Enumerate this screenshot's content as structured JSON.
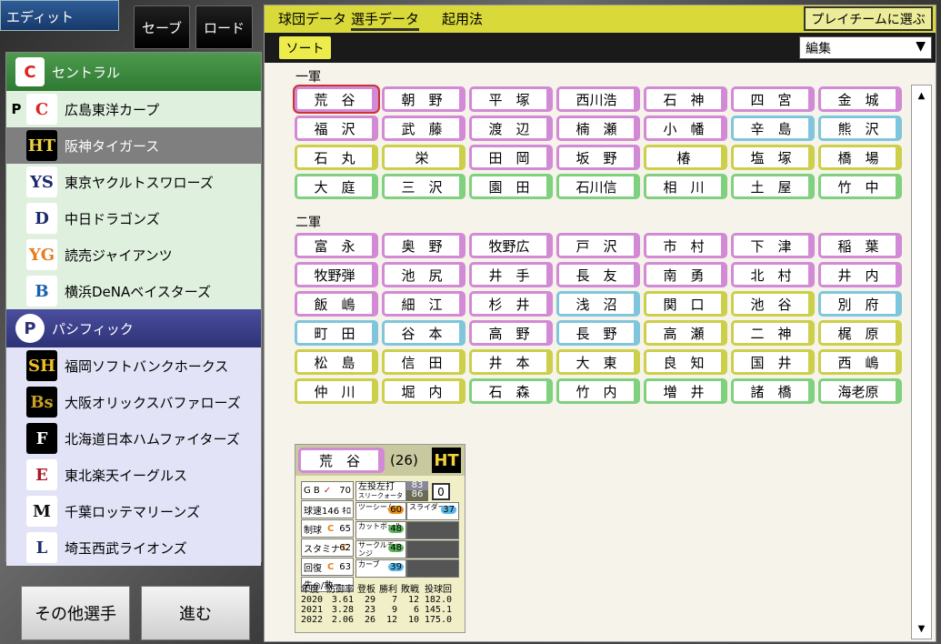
{
  "header": {
    "edit_label": "エディット",
    "save_label": "セーブ",
    "load_label": "ロード"
  },
  "teams": {
    "central_label": "セントラル",
    "pacific_label": "パシフィック",
    "central": [
      {
        "name": "広島東洋カープ",
        "mark": "P",
        "logo": "C"
      },
      {
        "name": "阪神タイガース",
        "mark": "",
        "logo": "HT"
      },
      {
        "name": "東京ヤクルトスワローズ",
        "mark": "",
        "logo": "YS"
      },
      {
        "name": "中日ドラゴンズ",
        "mark": "",
        "logo": "D"
      },
      {
        "name": "読売ジャイアンツ",
        "mark": "",
        "logo": "YG"
      },
      {
        "name": "横浜DeNAベイスターズ",
        "mark": "",
        "logo": "B"
      }
    ],
    "pacific": [
      {
        "name": "福岡ソフトバンクホークス",
        "logo": "SH"
      },
      {
        "name": "大阪オリックスバファローズ",
        "logo": "Bs"
      },
      {
        "name": "北海道日本ハムファイターズ",
        "logo": "F"
      },
      {
        "name": "東北楽天イーグルス",
        "logo": "E"
      },
      {
        "name": "千葉ロッテマリーンズ",
        "logo": "M"
      },
      {
        "name": "埼玉西武ライオンズ",
        "logo": "L"
      }
    ]
  },
  "bottom": {
    "others_label": "その他選手",
    "next_label": "進む"
  },
  "tabs": {
    "team": "球団データ",
    "player": "選手データ",
    "lineup": "起用法",
    "play_team": "プレイチームに選ぶ"
  },
  "toolbar": {
    "sort": "ソート",
    "edit_select": "編集"
  },
  "groups": {
    "first": "一軍",
    "second": "二軍"
  },
  "first_team": [
    [
      "荒　谷",
      "朝　野",
      "平　塚",
      "西川浩",
      "石　神",
      "四　宮",
      "金　城"
    ],
    [
      "福　沢",
      "武　藤",
      "渡　辺",
      "楠　瀬",
      "小　幡",
      "辛　島",
      "熊　沢"
    ],
    [
      "石　丸",
      "栄",
      "田　岡",
      "坂　野",
      "椿",
      "塩　塚",
      "橋　場"
    ],
    [
      "大　庭",
      "三　沢",
      "園　田",
      "石川信",
      "相　川",
      "土　屋",
      "竹　中"
    ]
  ],
  "second_team": [
    [
      "富　永",
      "奥　野",
      "牧野広",
      "戸　沢",
      "市　村",
      "下　津",
      "稲　葉"
    ],
    [
      "牧野弾",
      "池　尻",
      "井　手",
      "長　友",
      "南　勇",
      "北　村",
      "井　内"
    ],
    [
      "飯　嶋",
      "細　江",
      "杉　井",
      "浅　沼",
      "関　口",
      "池　谷",
      "別　府"
    ],
    [
      "町　田",
      "谷　本",
      "高　野",
      "長　野",
      "高　瀬",
      "二　神",
      "梶　原"
    ],
    [
      "松　島",
      "信　田",
      "井　本",
      "大　東",
      "良　知",
      "国　井",
      "西　嶋"
    ],
    [
      "仲　川",
      "堀　内",
      "石　森",
      "竹　内",
      "増　井",
      "諸　橋",
      "海老原"
    ]
  ],
  "card": {
    "name": "荒　谷",
    "age": "(26)",
    "logo": "HT",
    "gb": "G B",
    "gb_val": "70",
    "speed": "球速146",
    "speed_unit": "ｷﾛ",
    "control": "制球",
    "control_val": "65",
    "stamina": "スタミナ",
    "stamina_val": "62",
    "recovery": "回復",
    "recovery_val": "63",
    "role": "先◎/救ー",
    "hand": "左投左打",
    "type": "スリークォーター",
    "rating1": "83",
    "rating2": "86",
    "rating3": "0",
    "pitches": [
      {
        "name": "ツーシーム",
        "val": "60"
      },
      {
        "name": "スライダー",
        "val": "37"
      },
      {
        "name": "カットボール",
        "val": "48"
      },
      {
        "name": "サークルチェンジ",
        "val": "48"
      },
      {
        "name": "カーブ",
        "val": "39"
      }
    ],
    "table_header": [
      "年度",
      "防御率",
      "登板",
      "勝利",
      "敗戦",
      "投球回"
    ],
    "table_rows": [
      [
        "2020",
        "3.61",
        "29",
        "7",
        "12",
        "182.0"
      ],
      [
        "2021",
        "3.28",
        "23",
        "9",
        "6",
        "145.1"
      ],
      [
        "2022",
        "2.06",
        "26",
        "12",
        "10",
        "175.0"
      ]
    ]
  },
  "colors": {
    "central": "#2f7a33",
    "pacific": "#2d3276",
    "tab_bar": "#d9d93a",
    "pink": "#d38ad6",
    "blue": "#7fc6dc",
    "yellow": "#cccf49",
    "green": "#7fd07f"
  },
  "button_colors": {
    "first": [
      [
        "pink",
        "pink",
        "pink",
        "pink",
        "pink",
        "pink",
        "pink"
      ],
      [
        "pink",
        "pink",
        "pink",
        "pink",
        "pink",
        "blue",
        "blue"
      ],
      [
        "yellow",
        "yellow",
        "pink",
        "pink",
        "yellow",
        "yellow",
        "yellow"
      ],
      [
        "green",
        "green",
        "green",
        "green",
        "green",
        "green",
        "green"
      ]
    ],
    "second": [
      [
        "pink",
        "pink",
        "pink",
        "pink",
        "pink",
        "pink",
        "pink"
      ],
      [
        "pink",
        "pink",
        "pink",
        "pink",
        "pink",
        "pink",
        "pink"
      ],
      [
        "pink",
        "pink",
        "pink",
        "blue",
        "yellow",
        "yellow",
        "blue"
      ],
      [
        "blue",
        "blue",
        "pink",
        "blue",
        "yellow",
        "yellow",
        "yellow"
      ],
      [
        "yellow",
        "yellow",
        "yellow",
        "yellow",
        "yellow",
        "yellow",
        "yellow"
      ],
      [
        "yellow",
        "yellow",
        "green",
        "green",
        "green",
        "green",
        "green"
      ]
    ]
  }
}
